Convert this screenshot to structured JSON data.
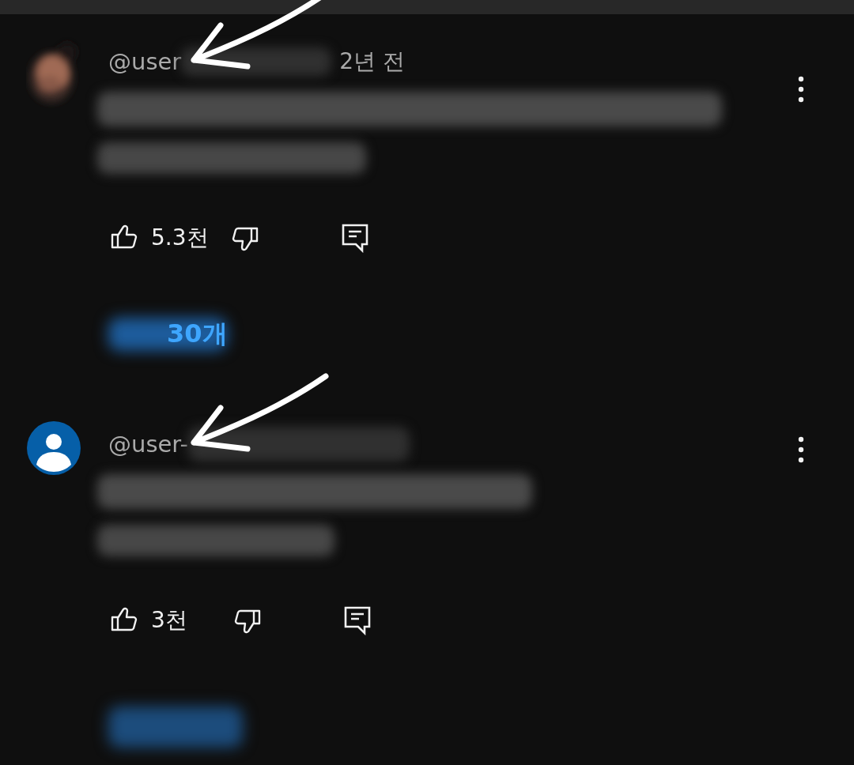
{
  "comments": [
    {
      "author": "@user",
      "time": "2년 전",
      "arrow_mark": true,
      "likes": "5.3천",
      "replies": "30개",
      "replies_blurred": true
    },
    {
      "avatar": {
        "kind": "default"
      },
      "author": "@user-",
      "arrow_mark": true,
      "likes": "3천",
      "replies_blurred": true
    }
  ]
}
